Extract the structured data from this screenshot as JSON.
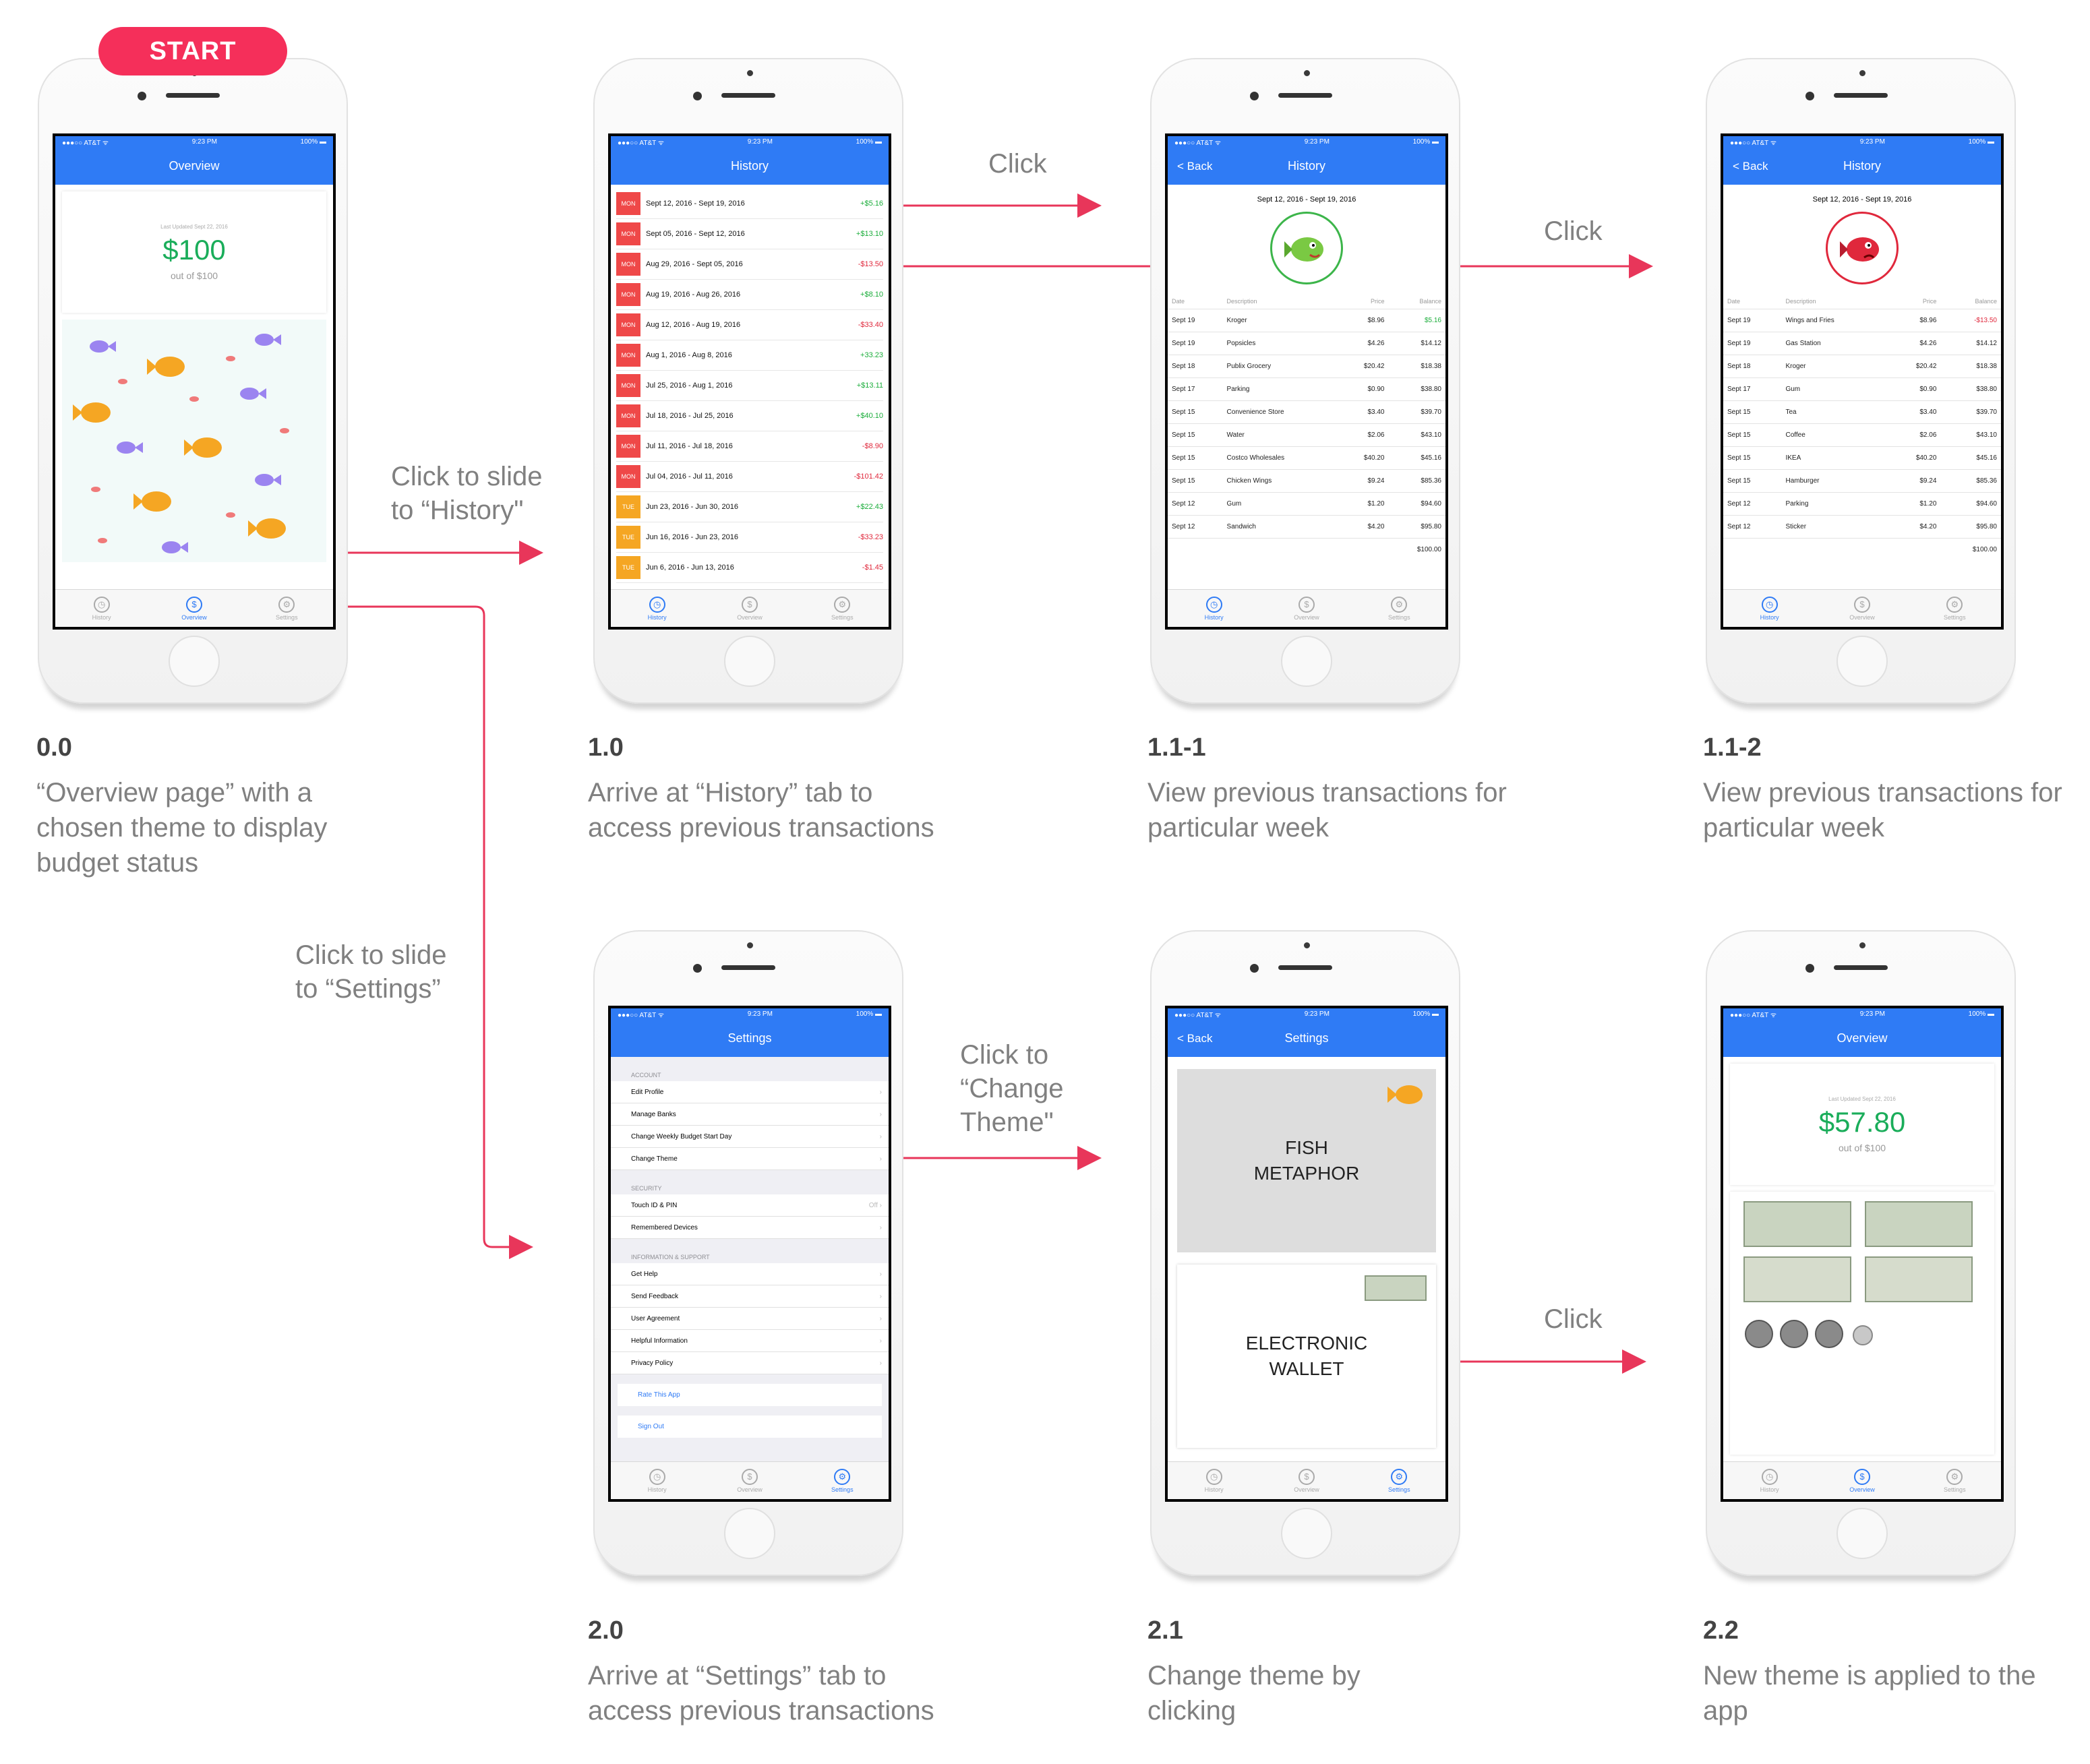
{
  "start_label": "START",
  "status": {
    "carrier": "●●●○○ AT&T ᯤ",
    "time": "9:23 PM",
    "battery": "100% ▬"
  },
  "tabs": {
    "history": "History",
    "overview": "Overview",
    "settings": "Settings"
  },
  "screen_00": {
    "nav_title": "Overview",
    "updated": "Last Updated Sept 22, 2016",
    "amount": "$100",
    "out_of": "out of $100"
  },
  "screen_10": {
    "nav_title": "History",
    "rows": [
      {
        "day": "MON",
        "range": "Sept 12, 2016 - Sept 19, 2016",
        "amount": "+$5.16"
      },
      {
        "day": "MON",
        "range": "Sept 05, 2016 - Sept 12, 2016",
        "amount": "+$13.10"
      },
      {
        "day": "MON",
        "range": "Aug 29, 2016 - Sept 05, 2016",
        "amount": "-$13.50"
      },
      {
        "day": "MON",
        "range": "Aug 19, 2016 - Aug 26, 2016",
        "amount": "+$8.10"
      },
      {
        "day": "MON",
        "range": "Aug 12, 2016 - Aug 19, 2016",
        "amount": "-$33.40"
      },
      {
        "day": "MON",
        "range": "Aug 1, 2016 - Aug 8, 2016",
        "amount": "+33.23"
      },
      {
        "day": "MON",
        "range": "Jul 25, 2016 - Aug 1, 2016",
        "amount": "+$13.11"
      },
      {
        "day": "MON",
        "range": "Jul 18, 2016 - Jul 25, 2016",
        "amount": "+$40.10"
      },
      {
        "day": "MON",
        "range": "Jul 11, 2016 - Jul 18, 2016",
        "amount": "-$8.90"
      },
      {
        "day": "MON",
        "range": "Jul 04, 2016 - Jul 11, 2016",
        "amount": "-$101.42"
      },
      {
        "day": "TUE",
        "range": "Jun 23, 2016 - Jun 30, 2016",
        "amount": "+$22.43"
      },
      {
        "day": "TUE",
        "range": "Jun 16, 2016 - Jun 23, 2016",
        "amount": "-$33.23"
      },
      {
        "day": "TUE",
        "range": "Jun 6, 2016 - Jun 13, 2016",
        "amount": "-$1.45"
      }
    ]
  },
  "screen_111": {
    "back": "< Back",
    "nav_title": "History",
    "week": "Sept 12, 2016 - Sept 19, 2016",
    "headers": [
      "Date",
      "Description",
      "Price",
      "Balance"
    ],
    "rows": [
      [
        "Sept 19",
        "Kroger",
        "$8.96",
        "$5.16"
      ],
      [
        "Sept 19",
        "Popsicles",
        "$4.26",
        "$14.12"
      ],
      [
        "Sept 18",
        "Publix Grocery",
        "$20.42",
        "$18.38"
      ],
      [
        "Sept 17",
        "Parking",
        "$0.90",
        "$38.80"
      ],
      [
        "Sept 15",
        "Convenience Store",
        "$3.40",
        "$39.70"
      ],
      [
        "Sept 15",
        "Water",
        "$2.06",
        "$43.10"
      ],
      [
        "Sept 15",
        "Costco Wholesales",
        "$40.20",
        "$45.16"
      ],
      [
        "Sept 15",
        "Chicken Wings",
        "$9.24",
        "$85.36"
      ],
      [
        "Sept 12",
        "Gum",
        "$1.20",
        "$94.60"
      ],
      [
        "Sept 12",
        "Sandwich",
        "$4.20",
        "$95.80"
      ]
    ],
    "total": "$100.00"
  },
  "screen_112": {
    "back": "< Back",
    "nav_title": "History",
    "week": "Sept 12, 2016 - Sept 19, 2016",
    "headers": [
      "Date",
      "Description",
      "Price",
      "Balance"
    ],
    "rows": [
      [
        "Sept 19",
        "Wings and Fries",
        "$8.96",
        "-$13.50"
      ],
      [
        "Sept 19",
        "Gas Station",
        "$4.26",
        "$14.12"
      ],
      [
        "Sept 18",
        "Kroger",
        "$20.42",
        "$18.38"
      ],
      [
        "Sept 17",
        "Gum",
        "$0.90",
        "$38.80"
      ],
      [
        "Sept 15",
        "Tea",
        "$3.40",
        "$39.70"
      ],
      [
        "Sept 15",
        "Coffee",
        "$2.06",
        "$43.10"
      ],
      [
        "Sept 15",
        "IKEA",
        "$40.20",
        "$45.16"
      ],
      [
        "Sept 15",
        "Hamburger",
        "$9.24",
        "$85.36"
      ],
      [
        "Sept 12",
        "Parking",
        "$1.20",
        "$94.60"
      ],
      [
        "Sept 12",
        "Sticker",
        "$4.20",
        "$95.80"
      ]
    ],
    "total": "$100.00"
  },
  "screen_20": {
    "nav_title": "Settings",
    "account": "ACCOUNT",
    "account_items": [
      "Edit Profile",
      "Manage Banks",
      "Change Weekly Budget Start Day",
      "Change Theme"
    ],
    "security": "SECURITY",
    "touch_id": "Touch ID & PIN",
    "touch_val": "Off",
    "remembered": "Remembered Devices",
    "info": "INFORMATION & SUPPORT",
    "info_items": [
      "Get Help",
      "Send Feedback",
      "User Agreement",
      "Helpful Information",
      "Privacy Policy"
    ],
    "rate": "Rate This App",
    "signout": "Sign Out"
  },
  "screen_21": {
    "back": "< Back",
    "nav_title": "Settings",
    "fish_line1": "FISH",
    "fish_line2": "METAPHOR",
    "wallet_line1": "ELECTRONIC",
    "wallet_line2": "WALLET"
  },
  "screen_22": {
    "nav_title": "Overview",
    "updated": "Last Updated Sept 22, 2016",
    "amount": "$57.80",
    "out_of": "out of $100"
  },
  "captions": [
    {
      "num": "0.0",
      "text": "“Overview page” with a chosen theme to display budget status"
    },
    {
      "num": "1.0",
      "text": "Arrive at “History” tab to access previous transactions"
    },
    {
      "num": "1.1-1",
      "text": "View previous transactions for particular week"
    },
    {
      "num": "1.1-2",
      "text": "View previous transactions for particular week"
    },
    {
      "num": "2.0",
      "text": "Arrive at “Settings” tab to access previous transactions"
    },
    {
      "num": "2.1",
      "text": "Change theme by clicking"
    },
    {
      "num": "2.2",
      "text": "New theme is applied to the app"
    }
  ],
  "flow": {
    "click1": "Click",
    "click2": "Click",
    "click3": "Click",
    "slide_history": "Click to slide to “History\"",
    "slide_settings": "Click to slide to “Settings”",
    "change_theme": "Click to “Change Theme\""
  },
  "colors": {
    "accent": "#2f7bf5",
    "arrow": "#e8365a",
    "positive": "#1aad3a",
    "negative": "#e0283c",
    "mon_badge": "#ef4848",
    "tue_badge": "#f5a623"
  }
}
